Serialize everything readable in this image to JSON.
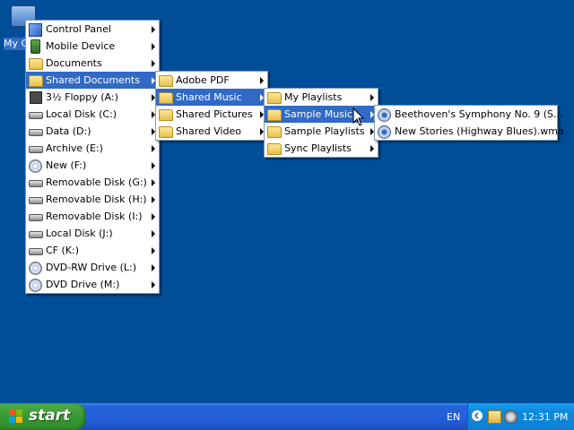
{
  "desktop": {
    "icon_label": "My C"
  },
  "menus": {
    "main": [
      {
        "label": "Control Panel",
        "icon": "control-panel-icon"
      },
      {
        "label": "Mobile Device",
        "icon": "mobile-device-icon"
      },
      {
        "label": "Documents",
        "icon": "folder-icon"
      },
      {
        "label": "Shared Documents",
        "icon": "folder-icon",
        "highlighted": true
      },
      {
        "label": "3½ Floppy (A:)",
        "icon": "floppy-icon"
      },
      {
        "label": "Local Disk (C:)",
        "icon": "drive-icon"
      },
      {
        "label": "Data (D:)",
        "icon": "drive-icon"
      },
      {
        "label": "Archive (E:)",
        "icon": "drive-icon"
      },
      {
        "label": "New (F:)",
        "icon": "cd-icon"
      },
      {
        "label": "Removable Disk (G:)",
        "icon": "drive-icon"
      },
      {
        "label": "Removable Disk (H:)",
        "icon": "drive-icon"
      },
      {
        "label": "Removable Disk (I:)",
        "icon": "drive-icon"
      },
      {
        "label": "Local Disk (J:)",
        "icon": "drive-icon"
      },
      {
        "label": "CF (K:)",
        "icon": "drive-icon"
      },
      {
        "label": "DVD-RW Drive (L:)",
        "icon": "dvd-icon"
      },
      {
        "label": "DVD Drive (M:)",
        "icon": "dvd-icon"
      }
    ],
    "shared_documents": [
      {
        "label": "Adobe PDF",
        "icon": "folder-icon"
      },
      {
        "label": "Shared Music",
        "icon": "music-folder-icon",
        "highlighted": true
      },
      {
        "label": "Shared Pictures",
        "icon": "pictures-folder-icon"
      },
      {
        "label": "Shared Video",
        "icon": "video-folder-icon"
      }
    ],
    "shared_music": [
      {
        "label": "My Playlists",
        "icon": "folder-icon"
      },
      {
        "label": "Sample Music",
        "icon": "folder-icon",
        "highlighted": true
      },
      {
        "label": "Sample Playlists",
        "icon": "folder-icon"
      },
      {
        "label": "Sync Playlists",
        "icon": "folder-icon"
      }
    ],
    "sample_music": [
      {
        "label": "Beethoven's Symphony No. 9 (S...",
        "icon": "audio-file-icon"
      },
      {
        "label": "New Stories (Highway Blues).wma",
        "icon": "audio-file-icon"
      }
    ]
  },
  "taskbar": {
    "start_label": "start",
    "language": "EN",
    "clock": "12:31 PM"
  },
  "colors": {
    "desktop": "#004e98",
    "highlight": "#316ac5",
    "taskbar": "#245edb",
    "start_button": "#3c9b36"
  }
}
